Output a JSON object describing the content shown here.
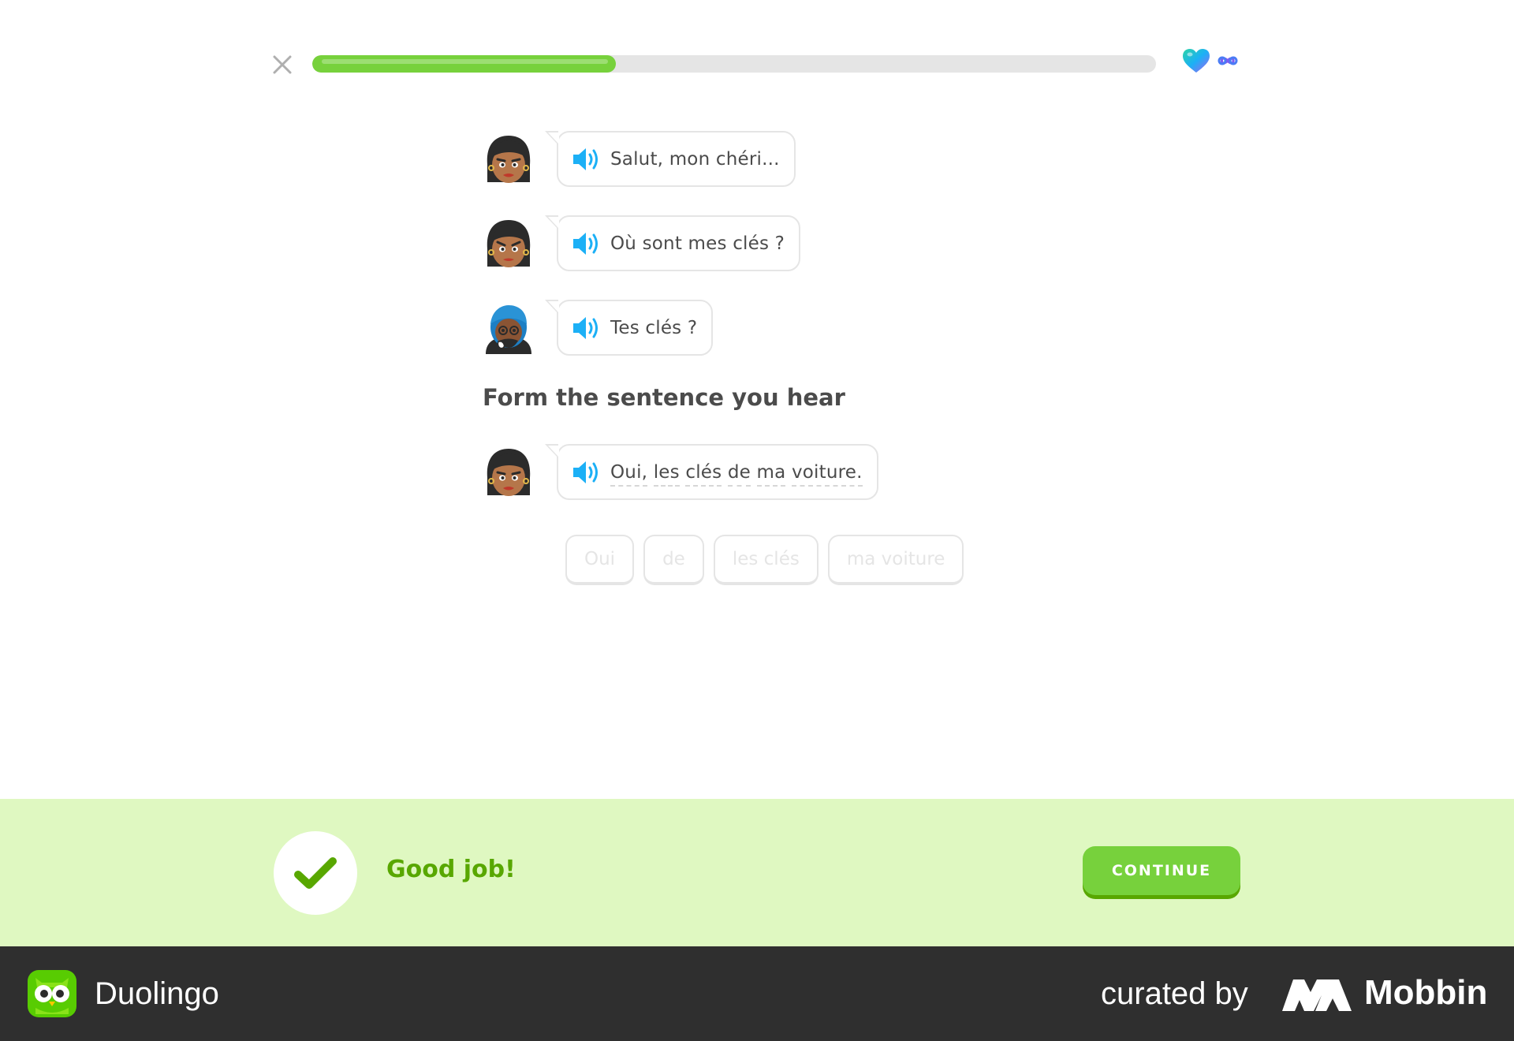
{
  "top_bar": {
    "close_icon": "close-icon",
    "progress": 0.36,
    "hearts_icon": "heart-icon",
    "hearts_value": "infinity"
  },
  "dialogue": [
    {
      "speaker": "woman-avatar",
      "text": "Salut, mon chéri..."
    },
    {
      "speaker": "woman-avatar",
      "text": "Où sont mes clés ?"
    },
    {
      "speaker": "man-avatar",
      "text": "Tes clés ?"
    }
  ],
  "prompt": {
    "title": "Form the sentence you hear",
    "speaker": "woman-avatar",
    "words": [
      "Oui,",
      "les",
      "clés",
      "de",
      "ma",
      "voiture."
    ]
  },
  "word_bank": [
    "Oui",
    "de",
    "les clés",
    "ma voiture"
  ],
  "feedback": {
    "message": "Good job!",
    "continue_label": "CONTINUE",
    "icon": "checkmark-icon"
  },
  "footer": {
    "app_name": "Duolingo",
    "curated_by": "curated by",
    "brand": "Mobbin"
  },
  "colors": {
    "green": "#77d13c",
    "green_dark": "#58a700",
    "feedback_bg": "#dff8c1",
    "speaker_blue": "#1cb0f6",
    "footer_bg": "#2f2f2f"
  }
}
